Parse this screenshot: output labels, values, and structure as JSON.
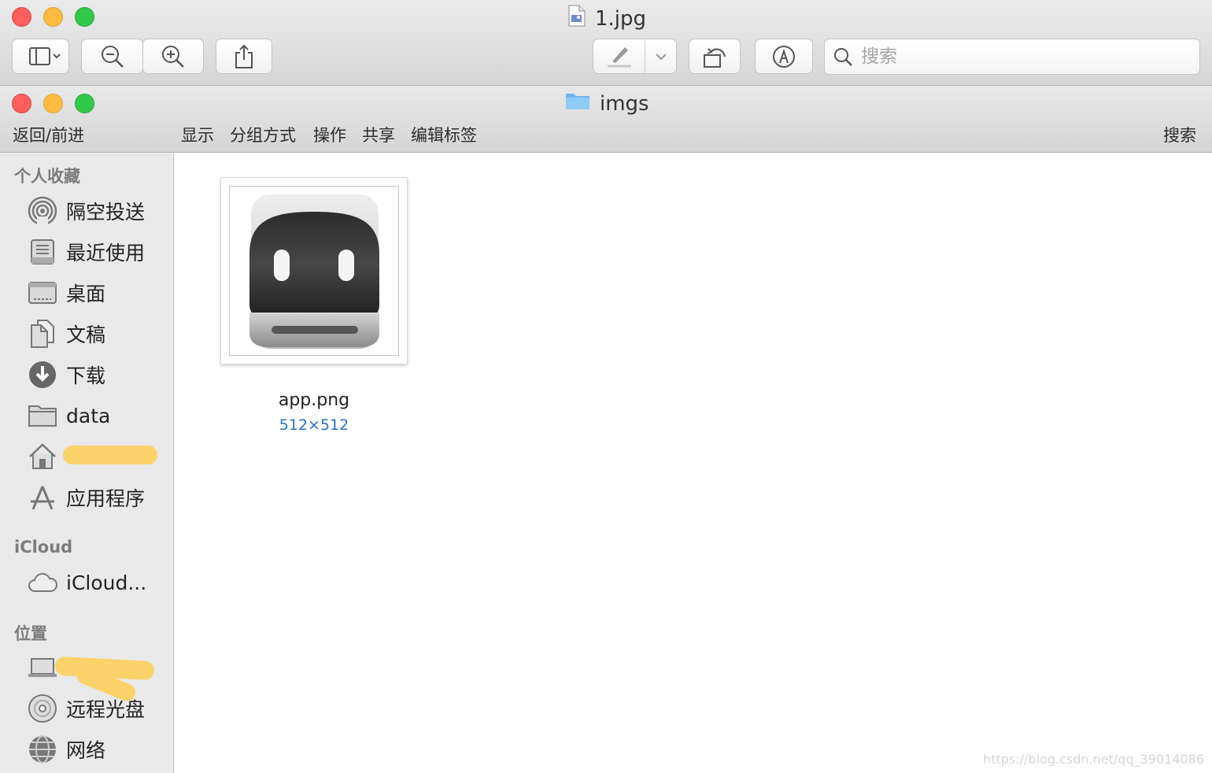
{
  "preview_window": {
    "title": "1.jpg",
    "search_placeholder": "搜索"
  },
  "finder_window": {
    "title": "imgs",
    "toolbar": {
      "back_forward": "返回/前进",
      "view": "显示",
      "group_by": "分组方式",
      "action": "操作",
      "share": "共享",
      "edit_tags": "编辑标签",
      "search": "搜索"
    },
    "sidebar": {
      "favorites_label": "个人收藏",
      "favorites": [
        {
          "label": "隔空投送",
          "icon": "airdrop-icon"
        },
        {
          "label": "最近使用",
          "icon": "recents-icon"
        },
        {
          "label": "桌面",
          "icon": "desktop-icon"
        },
        {
          "label": "文稿",
          "icon": "documents-icon"
        },
        {
          "label": "下载",
          "icon": "downloads-icon"
        },
        {
          "label": "data",
          "icon": "folder-icon"
        },
        {
          "label": "",
          "icon": "home-icon"
        },
        {
          "label": "应用程序",
          "icon": "applications-icon"
        }
      ],
      "icloud_label": "iCloud",
      "icloud": [
        {
          "label": "iCloud...",
          "icon": "cloud-icon"
        }
      ],
      "locations_label": "位置",
      "locations": [
        {
          "label": "",
          "icon": "laptop-icon"
        },
        {
          "label": "远程光盘",
          "icon": "remote-disc-icon"
        },
        {
          "label": "网络",
          "icon": "network-icon"
        }
      ]
    },
    "files": [
      {
        "name": "app.png",
        "dimensions": "512×512"
      }
    ]
  },
  "watermark": "https://blog.csdn.net/qq_39014086",
  "colors": {
    "traffic_red": "#fc605c",
    "traffic_yellow": "#fdbc40",
    "traffic_green": "#34c84a",
    "dimension_text": "#2c6fc7",
    "redaction": "#fcd26a"
  }
}
